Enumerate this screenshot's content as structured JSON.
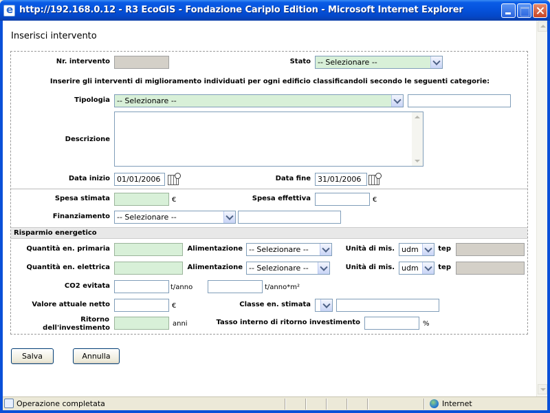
{
  "window": {
    "title": "http://192.168.0.12 - R3 EcoGIS - Fondazione Cariplo Edition - Microsoft Internet Explorer"
  },
  "page": {
    "title": "Inserisci intervento"
  },
  "form": {
    "nr_intervento_label": "Nr. intervento",
    "nr_intervento_value": "",
    "stato_label": "Stato",
    "stato_value": "-- Selezionare --",
    "instructions": "Inserire gli interventi di miglioramento individuati per ogni edificio classificandoli secondo le seguenti categorie:",
    "tipologia_label": "Tipologia",
    "tipologia_value": "-- Selezionare --",
    "tipologia_extra": "",
    "descrizione_label": "Descrizione",
    "data_inizio_label": "Data inizio",
    "data_inizio_value": "01/01/2006",
    "data_fine_label": "Data fine",
    "data_fine_value": "31/01/2006",
    "spesa_stimata_label": "Spesa stimata",
    "spesa_effettiva_label": "Spesa effettiva",
    "currency": "€",
    "finanziamento_label": "Finanziamento",
    "finanziamento_value": "-- Selezionare --",
    "risparmio_header": "Risparmio energetico",
    "qta_primaria_label": "Quantità en. primaria",
    "qta_elettrica_label": "Quantità en. elettrica",
    "alimentazione_label": "Alimentazione",
    "alimentazione_value": "-- Selezionare --",
    "unita_label": "Unità di mis.",
    "unita_value": "udm",
    "tep": "tep",
    "co2_label": "CO2 evitata",
    "co2_unit1": "t/anno",
    "co2_unit2": "t/anno*m²",
    "van_label": "Valore attuale netto",
    "classe_label": "Classe en. stimata",
    "ritorno_label_1": "Ritorno",
    "ritorno_label_2": "dell'investimento",
    "anni": "anni",
    "tasso_label": "Tasso interno di ritorno investimento",
    "percent": "%"
  },
  "buttons": {
    "salva": "Salva",
    "annulla": "Annulla"
  },
  "statusbar": {
    "text": "Operazione completata",
    "zone": "Internet"
  }
}
